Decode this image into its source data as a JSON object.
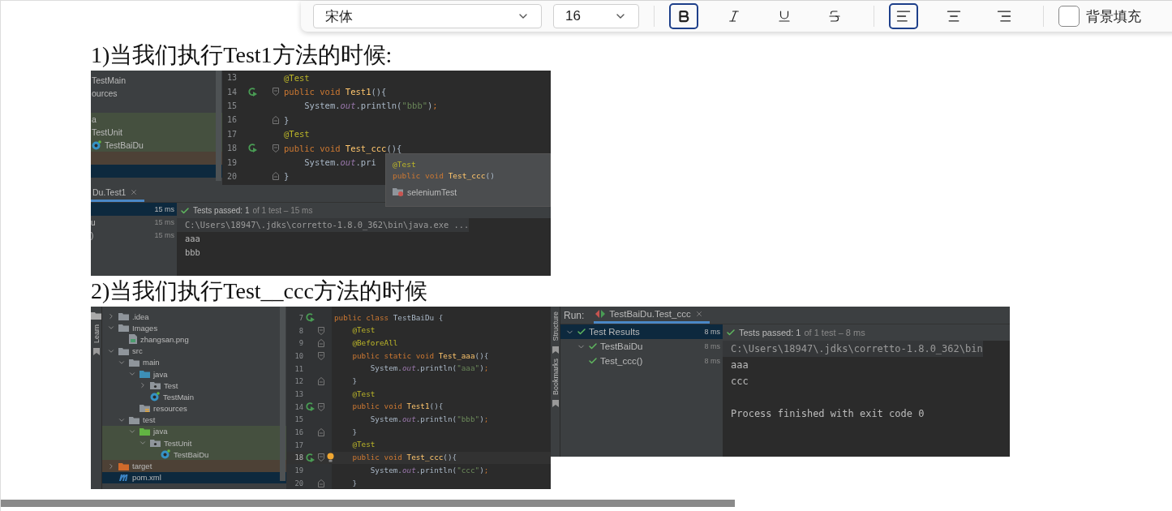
{
  "toolbar": {
    "font_family": "宋体",
    "font_size": "16",
    "format_buttons": [
      {
        "kind": "bold",
        "selected": true
      },
      {
        "kind": "italic",
        "selected": false
      },
      {
        "kind": "underline",
        "selected": false
      },
      {
        "kind": "strikethrough",
        "selected": false
      }
    ],
    "align_buttons": [
      {
        "kind": "left",
        "selected": true
      },
      {
        "kind": "center",
        "selected": false
      },
      {
        "kind": "right",
        "selected": false
      }
    ],
    "background_fill": {
      "label": "背景填充",
      "checked": false
    }
  },
  "sections": [
    {
      "heading": "1)当我们执行Test1方法的时候:",
      "screenshots": [
        {
          "kind": "ide_split",
          "project_tree": [
            {
              "label": "TestMain",
              "selected": false
            },
            {
              "label": "ources",
              "selected": false
            },
            {
              "kind": "empty"
            },
            {
              "label": "a",
              "color": "#45503f",
              "selected": false
            },
            {
              "label": "TestUnit",
              "color": "#45503f",
              "selected": false
            },
            {
              "label": "TestBaiDu",
              "kind": "class",
              "color": "#45503f",
              "selected": false
            },
            {
              "color": "#4d4136",
              "selected": false
            },
            {
              "selected": true
            }
          ],
          "editor": [
            {
              "number": "13",
              "tokens": [
                {
                  "kind": "annotation",
                  "text": "@Test"
                }
              ]
            },
            {
              "number": "14",
              "icons": [
                {
                  "kind": "run"
                },
                {
                  "kind": "fold_start"
                }
              ],
              "tokens": [
                {
                  "kind": "keyword",
                  "text": "public void "
                },
                {
                  "kind": "method",
                  "text": "Test1"
                },
                {
                  "kind": "plain",
                  "text": "(){"
                }
              ]
            },
            {
              "number": "15",
              "tokens": [
                {
                  "kind": "plain",
                  "text": "    System."
                },
                {
                  "kind": "field",
                  "text": "out"
                },
                {
                  "kind": "plain",
                  "text": ".println("
                },
                {
                  "kind": "string",
                  "text": "\"bbb\""
                },
                {
                  "kind": "plain",
                  "text": ")"
                },
                {
                  "kind": "keyword",
                  "text": ";"
                }
              ]
            },
            {
              "number": "16",
              "icons": [
                {
                  "kind": "fold_end"
                }
              ],
              "tokens": [
                {
                  "kind": "plain",
                  "text": "}"
                }
              ]
            },
            {
              "number": "17",
              "tokens": [
                {
                  "kind": "annotation",
                  "text": "@Test"
                }
              ]
            },
            {
              "number": "18",
              "icons": [
                {
                  "kind": "run"
                },
                {
                  "kind": "fold_start"
                }
              ],
              "tokens": [
                {
                  "kind": "keyword",
                  "text": "public void "
                },
                {
                  "kind": "method",
                  "text": "Test_ccc"
                },
                {
                  "kind": "plain",
                  "text": "(){"
                }
              ]
            },
            {
              "number": "19",
              "tokens": [
                {
                  "kind": "plain",
                  "text": "    System."
                },
                {
                  "kind": "field",
                  "text": "out"
                },
                {
                  "kind": "plain",
                  "text": ".pri"
                }
              ]
            },
            {
              "number": "20",
              "icons": [
                {
                  "kind": "fold_end"
                }
              ],
              "tokens": [
                {
                  "kind": "plain",
                  "text": "}"
                }
              ]
            }
          ],
          "popup": {
            "lines": [
              {
                "tokens": [
                  {
                    "kind": "annotation",
                    "text": "@Test"
                  }
                ]
              },
              {
                "tokens": [
                  {
                    "kind": "keyword",
                    "text": "public void "
                  },
                  {
                    "kind": "method",
                    "text": "Test_ccc"
                  },
                  {
                    "kind": "plain",
                    "text": "()"
                  }
                ]
              }
            ],
            "module": "seleniumTest"
          },
          "run_tab": "Du.Test1",
          "run_tree": [
            {
              "time": "15 ms",
              "selected": true
            },
            {
              "label": "u",
              "time": "15 ms",
              "selected": false
            },
            {
              "label": ")",
              "time": "15 ms",
              "selected": false
            }
          ],
          "status": {
            "kind": "passed",
            "summary": "Tests passed: 1",
            "detail": "of 1 test – 15 ms"
          },
          "console": [
            {
              "kind": "command",
              "text": "C:\\Users\\18947\\.jdks\\corretto-1.8.0_362\\bin\\java.exe ..."
            },
            {
              "kind": "output",
              "text": "aaa"
            },
            {
              "kind": "output",
              "text": "bbb"
            }
          ]
        }
      ]
    },
    {
      "heading": "2)当我们执行Test__ccc方法的时候",
      "screenshots": [
        {
          "kind": "ide_editor",
          "side_tabs": [
            {
              "label": "Learn"
            }
          ],
          "project_tree": [
            {
              "label": ".idea",
              "kind": "folder",
              "expanded": false,
              "selected": false
            },
            {
              "label": "Images",
              "kind": "folder",
              "expanded": true,
              "selected": false,
              "children": [
                {
                  "label": "zhangsan.png",
                  "kind": "image",
                  "selected": false
                }
              ]
            },
            {
              "label": "src",
              "kind": "folder",
              "expanded": true,
              "selected": false,
              "children": [
                {
                  "label": "main",
                  "kind": "folder",
                  "expanded": true,
                  "selected": false,
                  "children": [
                    {
                      "label": "java",
                      "kind": "source",
                      "expanded": true,
                      "selected": false,
                      "children": [
                        {
                          "label": "Test",
                          "kind": "package",
                          "expanded": false,
                          "selected": false
                        },
                        {
                          "label": "TestMain",
                          "kind": "class",
                          "selected": false
                        }
                      ]
                    },
                    {
                      "label": "resources",
                      "kind": "resources",
                      "selected": false
                    }
                  ]
                },
                {
                  "label": "test",
                  "kind": "folder",
                  "expanded": true,
                  "selected": false,
                  "children": [
                    {
                      "label": "java",
                      "kind": "test",
                      "color": "#45503f",
                      "expanded": true,
                      "selected": false,
                      "children": [
                        {
                          "label": "TestUnit",
                          "kind": "package",
                          "color": "#45503f",
                          "expanded": true,
                          "selected": false,
                          "children": [
                            {
                              "label": "TestBaiDu",
                              "kind": "class",
                              "color": "#45503f",
                              "selected": false
                            }
                          ]
                        }
                      ]
                    }
                  ]
                }
              ]
            },
            {
              "label": "target",
              "kind": "excluded",
              "color": "#4d4136",
              "expanded": false,
              "selected": false
            },
            {
              "label": "pom.xml",
              "kind": "maven",
              "selected": true
            }
          ],
          "editor": [
            {
              "number": "7",
              "icons": [
                {
                  "kind": "run"
                }
              ],
              "tokens": [
                {
                  "kind": "keyword",
                  "text": "public class "
                },
                {
                  "kind": "plain",
                  "text": "TestBaiDu {"
                }
              ]
            },
            {
              "number": "8",
              "icons": [
                {
                  "kind": "fold_start"
                }
              ],
              "tokens": [
                {
                  "kind": "annotation",
                  "text": "    @Test"
                }
              ]
            },
            {
              "number": "9",
              "icons": [
                {
                  "kind": "fold_end"
                }
              ],
              "tokens": [
                {
                  "kind": "annotation",
                  "text": "    @BeforeAll"
                }
              ]
            },
            {
              "number": "10",
              "icons": [
                {
                  "kind": "fold_start"
                }
              ],
              "tokens": [
                {
                  "kind": "keyword",
                  "text": "    public static void "
                },
                {
                  "kind": "method",
                  "text": "Test_aaa"
                },
                {
                  "kind": "plain",
                  "text": "(){"
                }
              ]
            },
            {
              "number": "11",
              "tokens": [
                {
                  "kind": "plain",
                  "text": "        System."
                },
                {
                  "kind": "field",
                  "text": "out"
                },
                {
                  "kind": "plain",
                  "text": ".println("
                },
                {
                  "kind": "string",
                  "text": "\"aaa\""
                },
                {
                  "kind": "plain",
                  "text": ")"
                },
                {
                  "kind": "keyword",
                  "text": ";"
                }
              ]
            },
            {
              "number": "12",
              "icons": [
                {
                  "kind": "fold_end"
                }
              ],
              "tokens": [
                {
                  "kind": "plain",
                  "text": "    }"
                }
              ]
            },
            {
              "number": "13",
              "tokens": [
                {
                  "kind": "annotation",
                  "text": "    @Test"
                }
              ]
            },
            {
              "number": "14",
              "icons": [
                {
                  "kind": "run"
                },
                {
                  "kind": "fold_start"
                }
              ],
              "tokens": [
                {
                  "kind": "keyword",
                  "text": "    public void "
                },
                {
                  "kind": "method",
                  "text": "Test1"
                },
                {
                  "kind": "plain",
                  "text": "(){"
                }
              ]
            },
            {
              "number": "15",
              "tokens": [
                {
                  "kind": "plain",
                  "text": "        System."
                },
                {
                  "kind": "field",
                  "text": "out"
                },
                {
                  "kind": "plain",
                  "text": ".println("
                },
                {
                  "kind": "string",
                  "text": "\"bbb\""
                },
                {
                  "kind": "plain",
                  "text": ")"
                },
                {
                  "kind": "keyword",
                  "text": ";"
                }
              ]
            },
            {
              "number": "16",
              "icons": [
                {
                  "kind": "fold_end"
                }
              ],
              "tokens": [
                {
                  "kind": "plain",
                  "text": "    }"
                }
              ]
            },
            {
              "number": "17",
              "tokens": [
                {
                  "kind": "annotation",
                  "text": "    @Test"
                }
              ]
            },
            {
              "number": "18",
              "current": true,
              "icons": [
                {
                  "kind": "run"
                },
                {
                  "kind": "fold_start"
                },
                {
                  "kind": "bulb"
                }
              ],
              "tokens": [
                {
                  "kind": "keyword",
                  "text": "    public void "
                },
                {
                  "kind": "method",
                  "text": "Test_ccc"
                },
                {
                  "kind": "plain",
                  "text": "(){"
                }
              ]
            },
            {
              "number": "19",
              "tokens": [
                {
                  "kind": "plain",
                  "text": "        System."
                },
                {
                  "kind": "field",
                  "text": "out"
                },
                {
                  "kind": "plain",
                  "text": ".println("
                },
                {
                  "kind": "string",
                  "text": "\"ccc\""
                },
                {
                  "kind": "plain",
                  "text": ")"
                },
                {
                  "kind": "keyword",
                  "text": ";"
                }
              ]
            },
            {
              "number": "20",
              "icons": [
                {
                  "kind": "fold_end"
                }
              ],
              "tokens": [
                {
                  "kind": "plain",
                  "text": "    }"
                }
              ]
            }
          ]
        },
        {
          "kind": "ide_run",
          "side_tabs": [
            {
              "label": "Structure"
            },
            {
              "label": "Bookmarks"
            }
          ],
          "run_label": "Run:",
          "run_tab": "TestBaiDu.Test_ccc",
          "run_tree": [
            {
              "label": "Test Results",
              "time": "8 ms",
              "passed": true,
              "expanded": true,
              "selected": true,
              "children": [
                {
                  "label": "TestBaiDu",
                  "time": "8 ms",
                  "passed": true,
                  "expanded": true,
                  "selected": false,
                  "children": [
                    {
                      "label": "Test_ccc()",
                      "time": "8 ms",
                      "passed": true,
                      "selected": false
                    }
                  ]
                }
              ]
            }
          ],
          "status": {
            "kind": "passed",
            "summary": "Tests passed: 1",
            "detail": "of 1 test – 8 ms"
          },
          "console": [
            {
              "kind": "command",
              "text": "C:\\Users\\18947\\.jdks\\corretto-1.8.0_362\\bin"
            },
            {
              "kind": "output",
              "text": "aaa"
            },
            {
              "kind": "output",
              "text": "ccc"
            },
            {
              "kind": "blank"
            },
            {
              "kind": "output",
              "text": "Process finished with exit code 0"
            }
          ]
        }
      ]
    }
  ]
}
